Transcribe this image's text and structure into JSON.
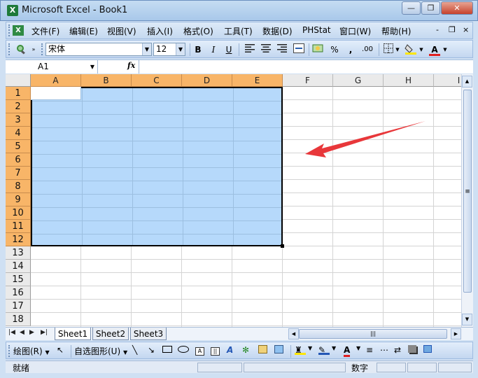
{
  "window": {
    "title": "Microsoft Excel - Book1",
    "app_icon": "X",
    "minimize_icon": "minimize-icon",
    "restore_icon": "restore-icon",
    "close_icon": "close-icon"
  },
  "menubar": {
    "items": [
      {
        "label": "文件(F)"
      },
      {
        "label": "编辑(E)"
      },
      {
        "label": "视图(V)"
      },
      {
        "label": "插入(I)"
      },
      {
        "label": "格式(O)"
      },
      {
        "label": "工具(T)"
      },
      {
        "label": "数据(D)"
      },
      {
        "label": "PHStat"
      },
      {
        "label": "窗口(W)"
      },
      {
        "label": "帮助(H)"
      }
    ],
    "doc_minimize": "-",
    "doc_restore": "❐",
    "doc_close": "×"
  },
  "format_toolbar": {
    "font_name": "宋体",
    "font_size": "12",
    "bold": "B",
    "italic": "I",
    "underline": "U",
    "percent": "%",
    "comma": ",",
    "decimals": ".00",
    "font_color": "A",
    "accent_red": "#e02020",
    "highlight_yellow": "#ffe600"
  },
  "formula_bar": {
    "name_box": "A1",
    "fx": "fx",
    "formula": ""
  },
  "sheet": {
    "columns": [
      "A",
      "B",
      "C",
      "D",
      "E",
      "F",
      "G",
      "H",
      "I"
    ],
    "selected_columns": [
      "A",
      "B",
      "C",
      "D",
      "E"
    ],
    "rows": [
      "1",
      "2",
      "3",
      "4",
      "5",
      "6",
      "7",
      "8",
      "9",
      "10",
      "11",
      "12",
      "13",
      "14",
      "15",
      "16",
      "17",
      "18"
    ],
    "selected_rows": [
      "1",
      "2",
      "3",
      "4",
      "5",
      "6",
      "7",
      "8",
      "9",
      "10",
      "11",
      "12"
    ],
    "selection_range": "A1:E12",
    "selection_color": "#b6d9fb",
    "header_selected_color": "#f8b568"
  },
  "sheet_tabs": {
    "tabs": [
      {
        "label": "Sheet1"
      },
      {
        "label": "Sheet2"
      },
      {
        "label": "Sheet3"
      }
    ],
    "active": "Sheet1"
  },
  "drawing_toolbar": {
    "draw_label": "绘图(R)",
    "autoshapes_label": "自选图形(U)"
  },
  "status_bar": {
    "status": "就绪",
    "mode": "数字"
  },
  "annotation": {
    "type": "red-arrow",
    "color": "#e8373a"
  }
}
